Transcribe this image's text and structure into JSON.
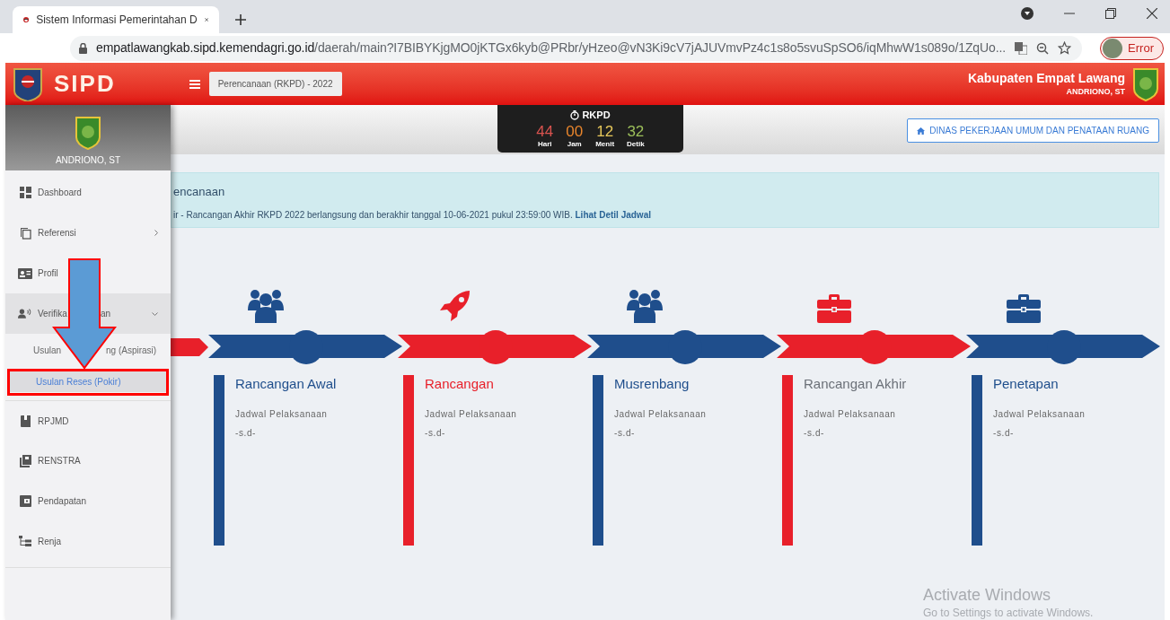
{
  "browser": {
    "tab_title": "Sistem Informasi Pemerintahan D",
    "url_domain": "empatlawangkab.sipd.kemendagri.go.id",
    "url_path": "/daerah/main?I7BIBYKjgMO0jKTGx6kyb@PRbr/yHzeo@vN3Ki9cV7jAJUVmvPz4c1s8o5svuSpSO6/iqMhwW1s089o/1ZqUo...",
    "profile_label": "Error"
  },
  "header": {
    "brand": "SIPD",
    "module": "Perencanaan (RKPD) - 2022",
    "region": "Kabupaten Empat Lawang",
    "user": "ANDRIONO, ST"
  },
  "countdown": {
    "title": "RKPD",
    "units": [
      {
        "value": "44",
        "label": "Hari",
        "color": "#d9534f"
      },
      {
        "value": "00",
        "label": "Jam",
        "color": "#e8852c"
      },
      {
        "value": "12",
        "label": "Menit",
        "color": "#e6c75a"
      },
      {
        "value": "32",
        "label": "Detik",
        "color": "#9cbf5a"
      }
    ]
  },
  "department_button": "DINAS PEKERJAAN UMUM DAN PENATAAN RUANG",
  "sidebar": {
    "user": "ANDRIONO, ST",
    "items": [
      {
        "kind": "item",
        "label": "Dashboard",
        "selected": false
      },
      {
        "kind": "submenu",
        "label": "Referensi",
        "selected": false
      },
      {
        "kind": "item",
        "label": "Profil",
        "selected": false
      },
      {
        "kind": "group",
        "label": "Verifika",
        "label_tail": "an",
        "expanded": true,
        "children": [
          {
            "label": "Usulan",
            "label_tail": "ng (Aspirasi)",
            "selected": false
          },
          {
            "label": "Usulan Reses (Pokir)",
            "selected": true
          }
        ]
      },
      {
        "kind": "item",
        "label": "RPJMD",
        "selected": false
      },
      {
        "kind": "item",
        "label": "RENSTRA",
        "selected": false
      },
      {
        "kind": "item",
        "label": "Pendapatan",
        "selected": false
      },
      {
        "kind": "item",
        "label": "Renja",
        "selected": false
      }
    ]
  },
  "alert": {
    "title": "encanaan",
    "text": "ir - Rancangan Akhir RKPD 2022 berlangsung dan berakhir tanggal 10-06-2021 pukul 23:59:00 WIB.",
    "link": "Lihat Detil Jadwal"
  },
  "timeline": [
    {
      "title": "Rancangan Awal",
      "color": "#1f4e8c",
      "current": false,
      "schedule_label": "Jadwal Pelaksanaan",
      "schedule": "-s.d-"
    },
    {
      "title": "Rancangan",
      "color": "#e8202a",
      "current": false,
      "schedule_label": "Jadwal Pelaksanaan",
      "schedule": "-s.d-"
    },
    {
      "title": "Musrenbang",
      "color": "#1f4e8c",
      "current": false,
      "schedule_label": "Jadwal Pelaksanaan",
      "schedule": "-s.d-"
    },
    {
      "title": "Rancangan Akhir",
      "color": "#e8202a",
      "current": true,
      "schedule_label": "Jadwal Pelaksanaan",
      "schedule": "-s.d-"
    },
    {
      "title": "Penetapan",
      "color": "#1f4e8c",
      "current": false,
      "schedule_label": "Jadwal Pelaksanaan",
      "schedule": "-s.d-"
    }
  ],
  "os_notice": {
    "title": "Activate Windows",
    "text": "Go to Settings to activate Windows."
  }
}
